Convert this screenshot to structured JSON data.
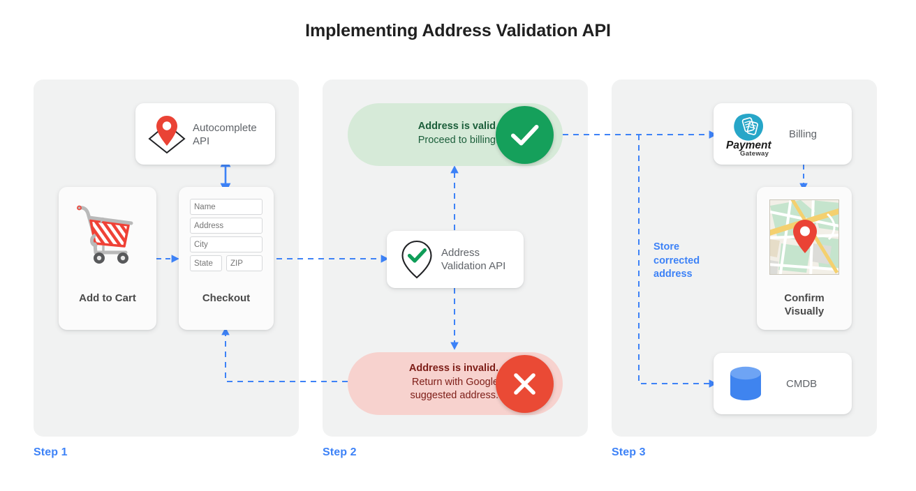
{
  "page": {
    "title": "Implementing Address Validation API",
    "accent_blue": "#3d82f7",
    "panel_bg": "#f1f2f2",
    "valid_bg": "#d6ead8",
    "invalid_bg": "#f7d2ce",
    "valid_badge": "#15a05b",
    "invalid_badge": "#ea4a35"
  },
  "steps": [
    {
      "label": "Step 1"
    },
    {
      "label": "Step 2"
    },
    {
      "label": "Step 3"
    }
  ],
  "step1": {
    "autocomplete_card": {
      "icon": "map-pin-diamond-icon",
      "line1": "Autocomplete",
      "line2": "API"
    },
    "cart_card": {
      "icon": "shopping-cart-icon",
      "label": "Add to Cart"
    },
    "checkout_card": {
      "label": "Checkout",
      "fields": [
        {
          "name": "name-field",
          "placeholder": "Name"
        },
        {
          "name": "address-field",
          "placeholder": "Address"
        },
        {
          "name": "city-field",
          "placeholder": "City"
        },
        {
          "name": "state-field",
          "placeholder": "State"
        },
        {
          "name": "zip-field",
          "placeholder": "ZIP"
        }
      ]
    }
  },
  "step2": {
    "valid_pill": {
      "headline": "Address is valid.",
      "detail": "Proceed to billing.",
      "badge_icon": "check-icon"
    },
    "validation_card": {
      "icon": "pin-check-icon",
      "line1": "Address",
      "line2": "Validation API"
    },
    "invalid_pill": {
      "headline": "Address is invalid.",
      "detail_line1": "Return with Google",
      "detail_line2": "suggested address.",
      "badge_icon": "close-icon"
    }
  },
  "step3": {
    "billing_card": {
      "icon": "payment-gateway-logo",
      "logo_word1": "Payment",
      "logo_word2": "Gateway",
      "label": "Billing"
    },
    "confirm_card": {
      "icon": "map-thumbnail-with-pin",
      "label_line1": "Confirm",
      "label_line2": "Visually"
    },
    "cmdb_card": {
      "icon": "database-cylinder-icon",
      "label": "CMDB"
    },
    "store_label_line1": "Store",
    "store_label_line2": "corrected",
    "store_label_line3": "address"
  }
}
